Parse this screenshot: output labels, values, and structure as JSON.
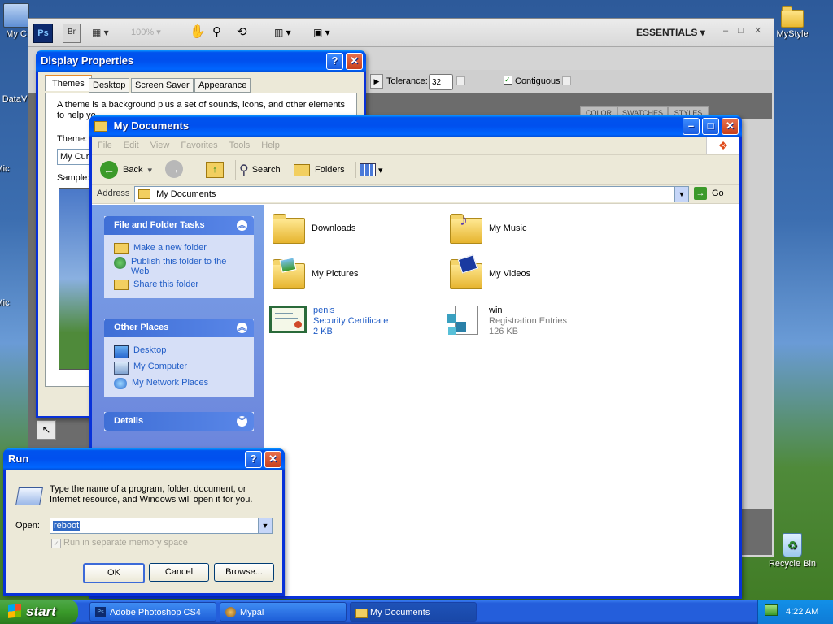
{
  "desktop": {
    "icons": [
      {
        "label": "My C"
      },
      {
        "label": "DataV"
      },
      {
        "label": "Mic"
      },
      {
        "label": "Mic"
      },
      {
        "label": "MyStyle"
      },
      {
        "label": "Recycle Bin"
      }
    ]
  },
  "photoshop": {
    "zoom": "100%",
    "workspace": "ESSENTIALS",
    "tolerance_label": "Tolerance:",
    "tolerance_value": "32",
    "contiguous_label": "Contiguous",
    "panel_tabs": [
      "COLOR",
      "SWATCHES",
      "STYLES"
    ]
  },
  "display_properties": {
    "title": "Display Properties",
    "tabs": [
      "Themes",
      "Desktop",
      "Screen Saver",
      "Appearance"
    ],
    "description": "A theme is a background plus a set of sounds, icons, and other elements to help yo",
    "theme_label": "Theme:",
    "theme_value": "My Curr",
    "sample_label": "Sample:"
  },
  "explorer": {
    "title": "My Documents",
    "menu": [
      "File",
      "Edit",
      "View",
      "Favorites",
      "Tools",
      "Help"
    ],
    "toolbar": {
      "back": "Back",
      "search": "Search",
      "folders": "Folders"
    },
    "address_label": "Address",
    "address_value": "My Documents",
    "go": "Go",
    "tasks": {
      "file_folder_title": "File and Folder Tasks",
      "file_folder_items": [
        "Make a new folder",
        "Publish this folder to the Web",
        "Share this folder"
      ],
      "other_places_title": "Other Places",
      "other_places_items": [
        "Desktop",
        "My Computer",
        "My Network Places"
      ],
      "details_title": "Details"
    },
    "items": [
      {
        "name": "Downloads"
      },
      {
        "name": "My Music"
      },
      {
        "name": "My Pictures"
      },
      {
        "name": "My Videos"
      },
      {
        "name": "penis",
        "type": "Security Certificate",
        "size": "2 KB"
      },
      {
        "name": "win",
        "type": "Registration Entries",
        "size": "126 KB"
      }
    ]
  },
  "run": {
    "title": "Run",
    "description": "Type the name of a program, folder, document, or Internet resource, and Windows will open it for you.",
    "open_label": "Open:",
    "open_value": "reboot",
    "checkbox_label": "Run in separate memory space",
    "ok": "OK",
    "cancel": "Cancel",
    "browse": "Browse..."
  },
  "taskbar": {
    "start": "start",
    "tasks": [
      "Adobe Photoshop CS4",
      "Mypal",
      "My Documents"
    ],
    "clock": "4:22 AM"
  }
}
